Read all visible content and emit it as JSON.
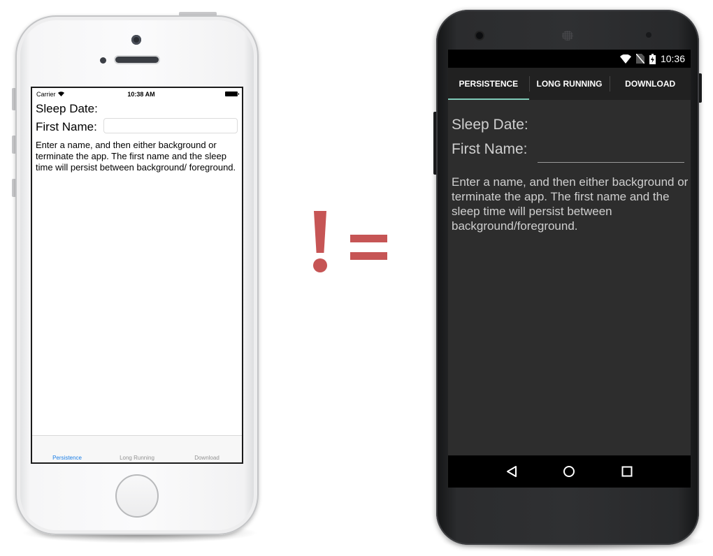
{
  "ios": {
    "status": {
      "carrier": "Carrier",
      "time": "10:38 AM"
    },
    "sleep_date_label": "Sleep Date:",
    "first_name_label": "First Name:",
    "first_name_value": "",
    "instructions": "Enter a name, and then either background or terminate the app. The first name and the sleep time will persist between background/ foreground.",
    "tabs": [
      {
        "label": "Persistence",
        "active": true
      },
      {
        "label": "Long Running",
        "active": false
      },
      {
        "label": "Download",
        "active": false
      }
    ]
  },
  "android": {
    "status": {
      "time": "10:36"
    },
    "tabs": [
      {
        "label": "PERSISTENCE",
        "active": true
      },
      {
        "label": "LONG RUNNING",
        "active": false
      },
      {
        "label": "DOWNLOAD",
        "active": false
      }
    ],
    "sleep_date_label": "Sleep Date:",
    "first_name_label": "First Name:",
    "first_name_value": "",
    "instructions": "Enter a name, and then either background or terminate the app. The first name and the sleep time will persist between background/foreground.",
    "nav": [
      "back-icon",
      "home-icon",
      "recents-icon"
    ]
  },
  "colors": {
    "ios_accent": "#1a7ee6",
    "android_tab_indicator": "#7fcbb8",
    "not_equal_sign": "#c65555"
  }
}
